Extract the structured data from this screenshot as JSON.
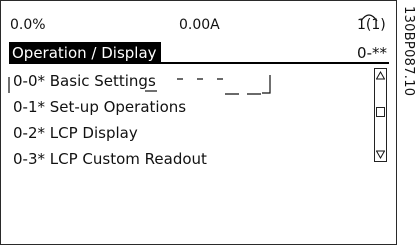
{
  "status": {
    "left_value": "0.0%",
    "center_value": "0.00A",
    "setup_indicator": "1(1)"
  },
  "header": {
    "title": "Operation / Display",
    "code": "0-**"
  },
  "menu": {
    "items": [
      {
        "label": "0-0* Basic Settings",
        "selected": true
      },
      {
        "label": "0-1* Set-up Operations",
        "selected": false
      },
      {
        "label": "0-2* LCP Display",
        "selected": false
      },
      {
        "label": "0-3* LCP Custom Readout",
        "selected": false
      }
    ]
  },
  "scrollbar": {
    "position": 0.45,
    "up_icon": "triangle-up-icon",
    "down_icon": "triangle-down-icon"
  },
  "side_reference": "130BP087.10",
  "colors": {
    "header_bg": "#000000",
    "header_text": "#ffffff",
    "text": "#111111",
    "border": "#2a2a2a"
  }
}
